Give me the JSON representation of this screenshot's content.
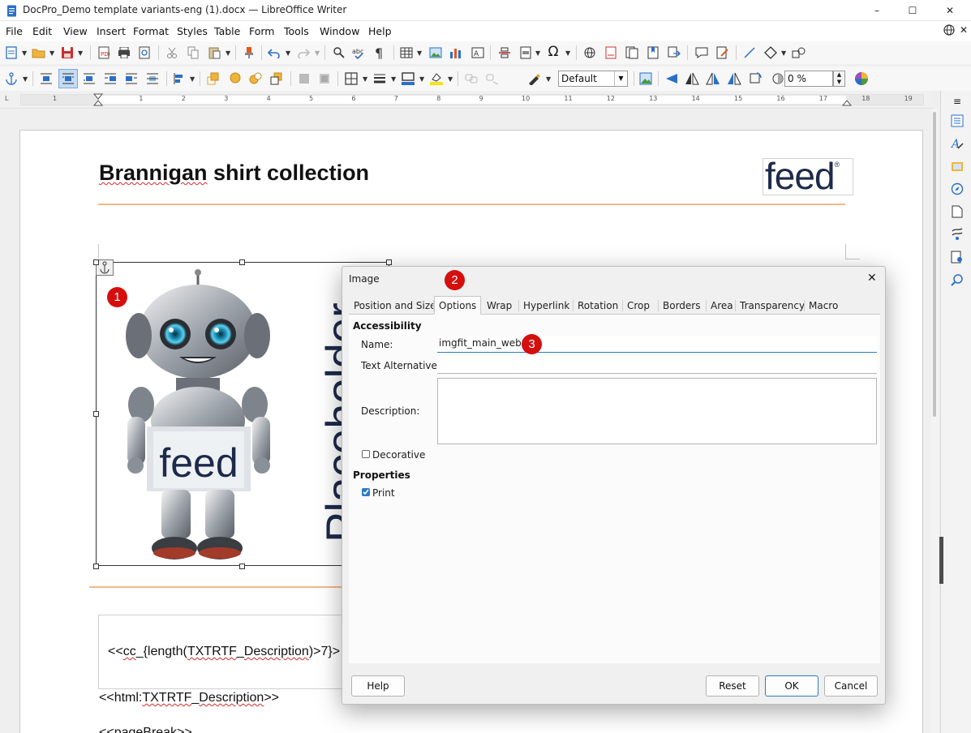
{
  "window": {
    "title": "DocPro_Demo template variants-eng (1).docx — LibreOffice Writer",
    "controls": {
      "minimize": "–",
      "maximize": "☐",
      "close": "✕"
    }
  },
  "menubar": {
    "items": [
      "File",
      "Edit",
      "View",
      "Insert",
      "Format",
      "Styles",
      "Table",
      "Form",
      "Tools",
      "Window",
      "Help"
    ],
    "close_doc": "✕"
  },
  "toolbar2": {
    "frame_style_value": "Default",
    "transparency_value": "0 %"
  },
  "ruler": {
    "numbers": [
      "1",
      "1",
      "2",
      "3",
      "4",
      "5",
      "6",
      "7",
      "8",
      "9",
      "10",
      "11",
      "12",
      "13",
      "14",
      "15",
      "16",
      "17",
      "18",
      "19"
    ]
  },
  "document": {
    "heading": "Brannigan shirt collection",
    "logo_text": "feed",
    "logo_mark": "®",
    "image_vertical_text": "Placeholder",
    "image_sign_text": "feed",
    "field_line": "<<cc_{length(TXTRTF_Description)>7}>",
    "html_line": "<<html:TXTRTF_Description>>",
    "page_break_line": "<<pageBreak>>"
  },
  "annotations": {
    "one": "1",
    "two": "2",
    "three": "3"
  },
  "dialog": {
    "title": "Image",
    "close": "✕",
    "tabs": [
      "Position and Size",
      "Options",
      "Wrap",
      "Hyperlink",
      "Rotation",
      "Crop",
      "Borders",
      "Area",
      "Transparency",
      "Macro"
    ],
    "active_tab": "Options",
    "accessibility_heading": "Accessibility",
    "name_label": "Name:",
    "name_value": "imgfit_main_web",
    "text_alt_label": "Text Alternative:",
    "text_alt_value": "",
    "description_label": "Description:",
    "description_value": "",
    "decorative_label": "Decorative",
    "decorative_checked": false,
    "properties_heading": "Properties",
    "print_label": "Print",
    "print_checked": true,
    "buttons": {
      "help": "Help",
      "reset": "Reset",
      "ok": "OK",
      "cancel": "Cancel"
    }
  },
  "colors": {
    "accent_blue": "#2e7ac4",
    "annotation_red": "#d50e0e",
    "rule_orange": "#f2b985",
    "logo_navy": "#1d2a4a"
  }
}
